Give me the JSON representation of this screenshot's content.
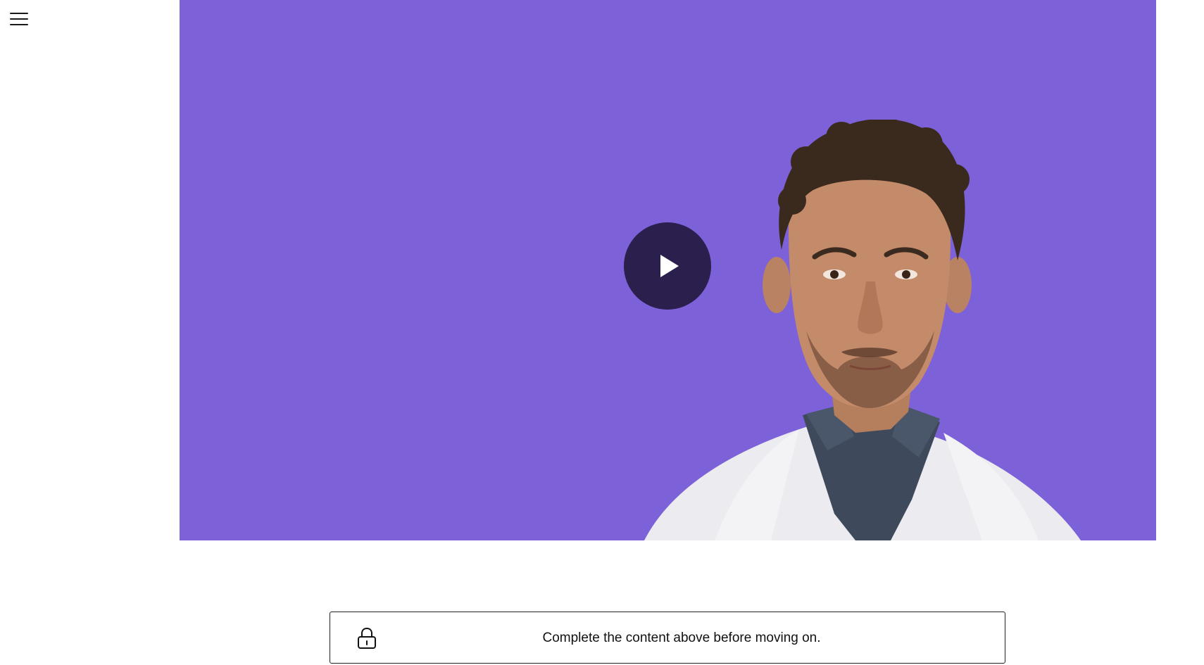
{
  "header": {
    "menu_icon": "hamburger-menu-icon"
  },
  "video": {
    "background_color": "#7d61d8",
    "play_button_color": "#2a1f4d",
    "play_icon": "play-icon"
  },
  "notice": {
    "icon": "lock-icon",
    "text": "Complete the content above before moving on."
  }
}
